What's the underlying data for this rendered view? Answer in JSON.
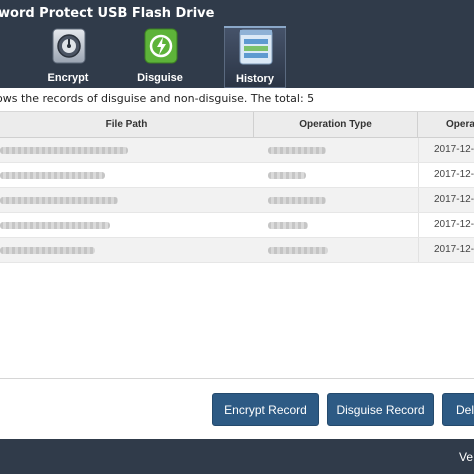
{
  "app": {
    "title": "word Protect USB Flash Drive"
  },
  "nav": [
    {
      "label": "Encrypt",
      "icon": "safe-dial-icon"
    },
    {
      "label": "Disguise",
      "icon": "usb-disguise-icon"
    },
    {
      "label": "History",
      "icon": "history-list-icon"
    }
  ],
  "info": {
    "text": "ows the records of disguise and non-disguise. The total: 5"
  },
  "table": {
    "headers": {
      "file_path": "File Path",
      "operation_type": "Operation Type",
      "operation_time": "Opera"
    },
    "rows": [
      {
        "time": "2017-12-"
      },
      {
        "time": "2017-12-"
      },
      {
        "time": "2017-12-"
      },
      {
        "time": "2017-12-"
      },
      {
        "time": "2017-12-"
      }
    ]
  },
  "buttons": {
    "encrypt_record": "Encrypt Record",
    "disguise_record": "Disguise Record",
    "delete": "Del"
  },
  "status": {
    "text": "Ve"
  },
  "colors": {
    "header_bg": "#303b4a",
    "button_bg": "#2d5a84"
  }
}
